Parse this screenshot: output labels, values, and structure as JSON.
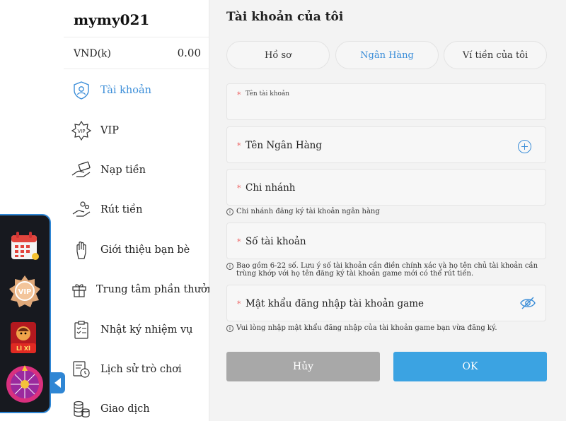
{
  "sidebar": {
    "username": "mymy021",
    "balance": {
      "currency": "VND(k)",
      "amount": "0.00"
    },
    "items": [
      {
        "label": "Tài khoản",
        "icon": "user-shield-icon",
        "active": true
      },
      {
        "label": "VIP",
        "icon": "vip-badge-icon",
        "active": false
      },
      {
        "label": "Nạp tiền",
        "icon": "deposit-hand-icon",
        "active": false
      },
      {
        "label": "Rút tiền",
        "icon": "withdraw-coins-icon",
        "active": false
      },
      {
        "label": "Giới thiệu bạn bè",
        "icon": "refer-hand-icon",
        "active": false
      },
      {
        "label": "Trung tâm phần thưởng",
        "icon": "gift-icon",
        "active": false
      },
      {
        "label": "Nhật ký nhiệm vụ",
        "icon": "clipboard-icon",
        "active": false
      },
      {
        "label": "Lịch sử trò chơi",
        "icon": "history-icon",
        "active": false
      },
      {
        "label": "Giao dịch",
        "icon": "coin-stack-icon",
        "active": false
      }
    ]
  },
  "floating_widget": {
    "items": [
      {
        "icon": "calendar-icon"
      },
      {
        "icon": "vip-medal-icon",
        "text": "VIP"
      },
      {
        "icon": "lucky-money-icon",
        "text": "LÌ XÌ"
      },
      {
        "icon": "lucky-wheel-icon"
      }
    ],
    "toggle_icon": "collapse-arrow-icon"
  },
  "main": {
    "title": "Tài khoản của tôi",
    "tabs": [
      {
        "label": "Hồ sơ",
        "active": false
      },
      {
        "label": "Ngân Hàng",
        "active": true
      },
      {
        "label": "Ví tiền của tôi",
        "active": false
      }
    ],
    "fields": {
      "account_name": {
        "label": "Tên tài khoản",
        "value": ""
      },
      "bank_name": {
        "label": "Tên Ngân Hàng",
        "value": ""
      },
      "branch": {
        "label": "Chi nhánh",
        "value": ""
      },
      "account_number": {
        "label": "Số tài khoản",
        "value": ""
      },
      "game_password": {
        "label": "Mật khẩu đăng nhập tài khoản game",
        "value": ""
      }
    },
    "hints": {
      "branch": "Chi nhánh đăng ký tài khoản ngân hàng",
      "account_number": "Bao gồm 6-22 số. Lưu ý số tài khoản cần điền chính xác và họ tên chủ tài khoản cần trùng khớp với họ tên đăng ký tài khoản game mới có thể rút tiền.",
      "game_password": "Vui lòng nhập mật khẩu đăng nhập của tài khoản game bạn vừa đăng ký."
    },
    "buttons": {
      "cancel": "Hủy",
      "ok": "OK"
    },
    "required_marker": "*"
  },
  "colors": {
    "accent": "#3a8dd8",
    "ok_button": "#3ba3e2",
    "cancel_button": "#a8a8a8",
    "main_bg": "#f3f3f3",
    "widget_bg": "#17191f"
  }
}
